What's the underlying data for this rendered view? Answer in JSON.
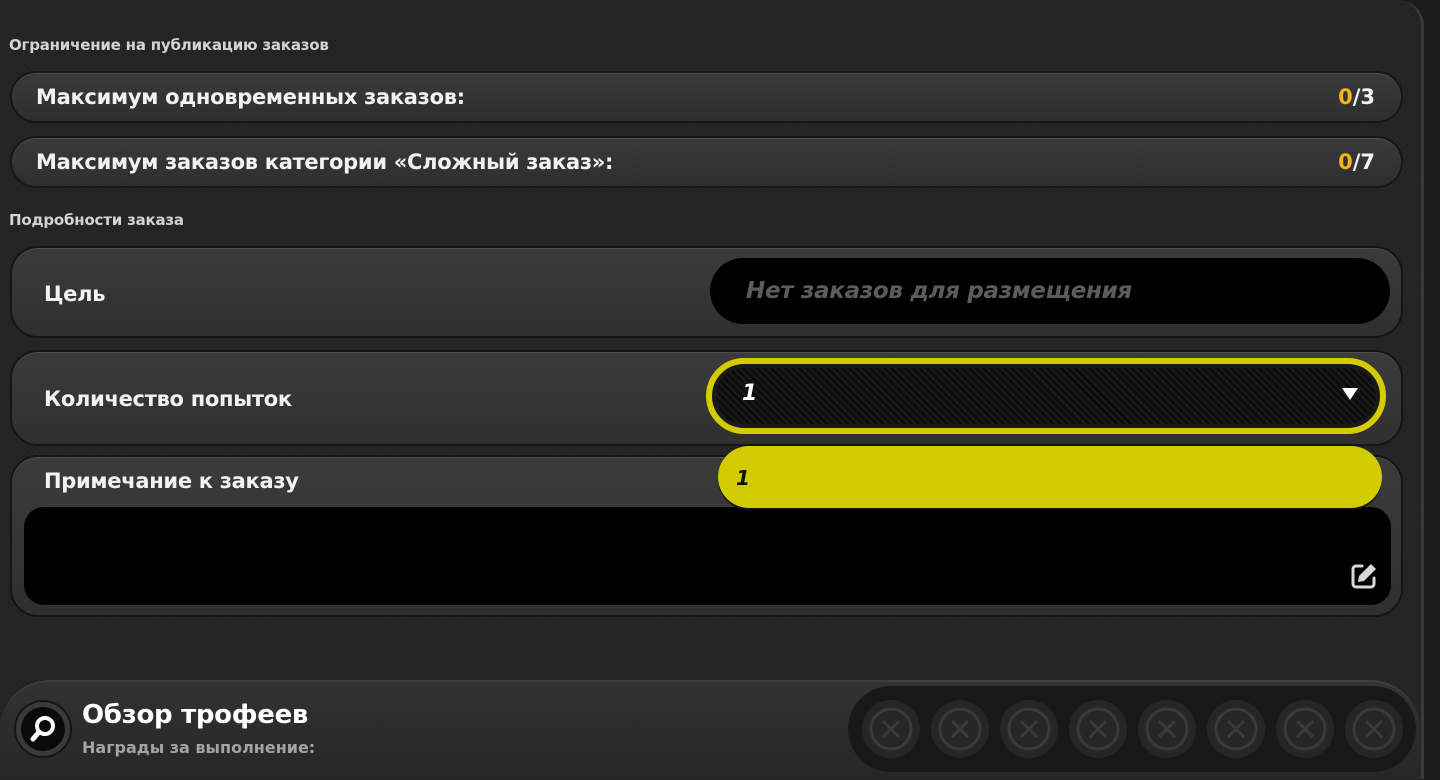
{
  "limits": {
    "section_label": "Ограничение на публикацию заказов",
    "rows": [
      {
        "label": "Максимум одновременных заказов:",
        "current": "0",
        "max": "/3"
      },
      {
        "label": "Максимум заказов категории «Сложный заказ»:",
        "current": "0",
        "max": "/7"
      }
    ]
  },
  "details": {
    "section_label": "Подробности заказа",
    "goal": {
      "label": "Цель",
      "placeholder": "Нет заказов для размещения"
    },
    "attempts": {
      "label": "Количество попыток",
      "selected": "1",
      "options": [
        "1"
      ]
    },
    "note": {
      "label": "Примечание к заказу",
      "value": ""
    }
  },
  "trophies": {
    "title": "Обзор трофеев",
    "subtitle": "Награды за выполнение:",
    "slot_icon": "x-circle-icon"
  },
  "colors": {
    "accent_yellow": "#d4cc00",
    "count_orange": "#f4b41a",
    "placeholder_gray": "#5c5c5c"
  }
}
